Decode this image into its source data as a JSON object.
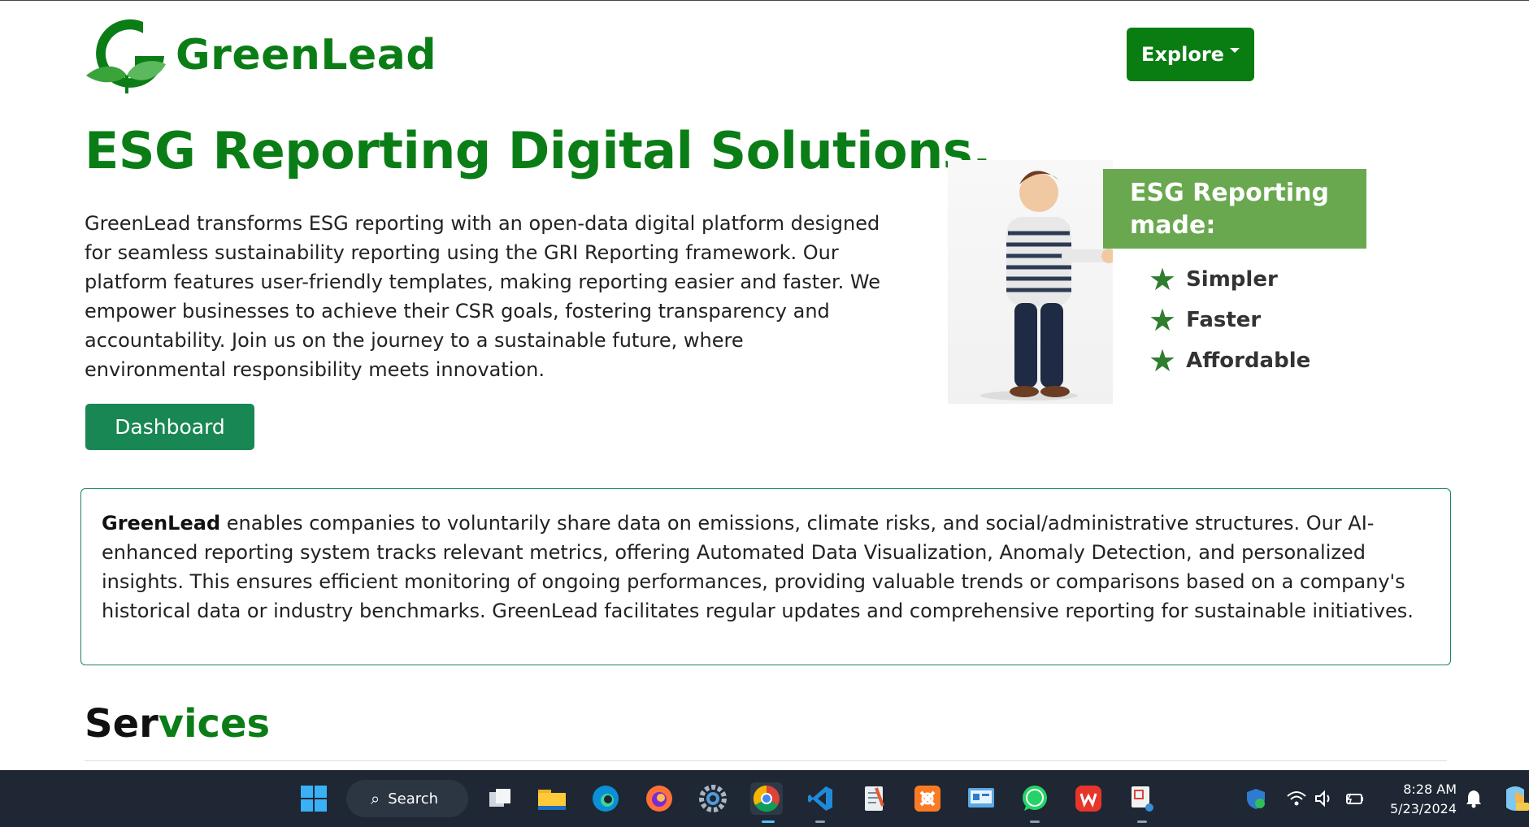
{
  "brand": {
    "name": "GreenLead"
  },
  "nav": {
    "explore_label": "Explore"
  },
  "hero": {
    "title": "ESG Reporting Digital Solutions.",
    "description": "GreenLead transforms ESG reporting with an open-data digital platform designed for seamless sustainability reporting using the GRI Reporting framework. Our platform features user-friendly templates, making reporting easier and faster. We empower businesses to achieve their CSR goals, fostering transparency and accountability. Join us on the journey to a sustainable future, where environmental responsibility meets innovation.",
    "dashboard_label": "Dashboard"
  },
  "promo": {
    "banner": "ESG Reporting made:",
    "items": [
      "Simpler",
      "Faster",
      "Affordable"
    ]
  },
  "about": {
    "brand": "GreenLead",
    "text": " enables companies to voluntarily share data on emissions, climate risks, and social/administrative structures. Our AI-enhanced reporting system tracks relevant metrics, offering Automated Data Visualization, Anomaly Detection, and personalized insights. This ensures efficient monitoring of ongoing performances, providing valuable trends or comparisons based on a company's historical data or industry benchmarks. GreenLead facilitates regular updates and comprehensive reporting for sustainable initiatives."
  },
  "services": {
    "title_part1": "Ser",
    "title_part2": "vices"
  },
  "taskbar": {
    "search_label": "Search",
    "time": "8:28 AM",
    "date": "5/23/2024",
    "apps": [
      "windows-start",
      "task-view",
      "file-explorer",
      "edge",
      "firefox",
      "settings",
      "chrome",
      "vscode",
      "notepad",
      "xampp",
      "control-panel",
      "whatsapp",
      "wps-office",
      "snipping-tool"
    ]
  },
  "colors": {
    "brand_green": "#0b7d16",
    "button_green": "#198754",
    "banner_green": "#6aa84f",
    "taskbar": "#1e2733"
  }
}
